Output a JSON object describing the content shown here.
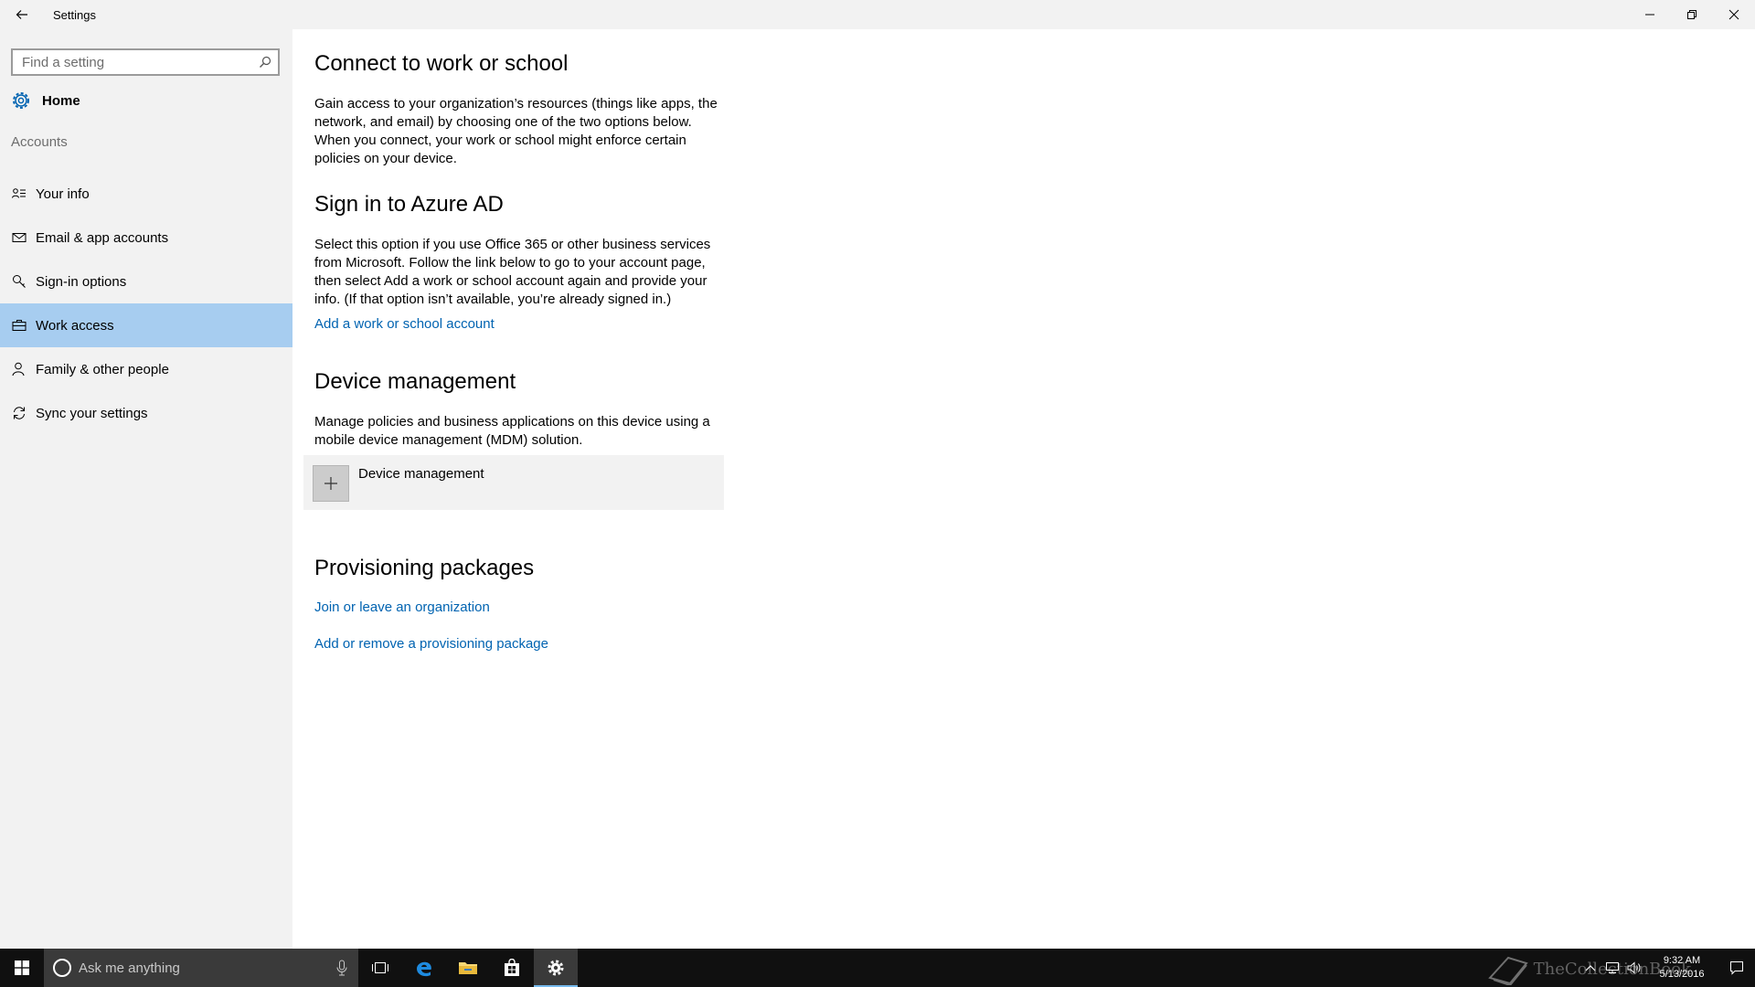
{
  "window": {
    "title": "Settings"
  },
  "search": {
    "placeholder": "Find a setting"
  },
  "home": {
    "label": "Home"
  },
  "sidebar": {
    "section": "Accounts",
    "items": [
      {
        "label": "Your info",
        "icon": "person-list-icon",
        "selected": false
      },
      {
        "label": "Email & app accounts",
        "icon": "mail-icon",
        "selected": false
      },
      {
        "label": "Sign-in options",
        "icon": "key-icon",
        "selected": false
      },
      {
        "label": "Work access",
        "icon": "briefcase-icon",
        "selected": true
      },
      {
        "label": "Family & other people",
        "icon": "people-icon",
        "selected": false
      },
      {
        "label": "Sync your settings",
        "icon": "sync-icon",
        "selected": false
      }
    ]
  },
  "main": {
    "connect": {
      "title": "Connect to work or school",
      "body": "Gain access to your organization’s resources (things like apps, the network, and email) by choosing one of the two options below. When you connect, your work or school might enforce certain policies on your device."
    },
    "azure": {
      "title": "Sign in to Azure AD",
      "body": "Select this option if you use Office 365 or other business services from Microsoft. Follow the link below to go to your account page, then select Add a work or school account again and provide your info. (If that option isn’t available, you’re already signed in.)",
      "link": "Add a work or school account"
    },
    "device": {
      "title": "Device management",
      "body": "Manage policies and business applications on this device using a mobile device management (MDM) solution.",
      "button_label": "Device management"
    },
    "provisioning": {
      "title": "Provisioning packages",
      "link1": "Join or leave an organization",
      "link2": "Add or remove a provisioning package"
    }
  },
  "taskbar": {
    "search_text": "Ask me anything",
    "time": "9:32 AM",
    "date": "5/13/2016",
    "watermark": "TheCollectionBook"
  },
  "colors": {
    "accent": "#0063b1",
    "selected_bg": "#a7cdf0",
    "sidebar_bg": "#f2f2f2",
    "taskbar_bg": "#101010"
  }
}
